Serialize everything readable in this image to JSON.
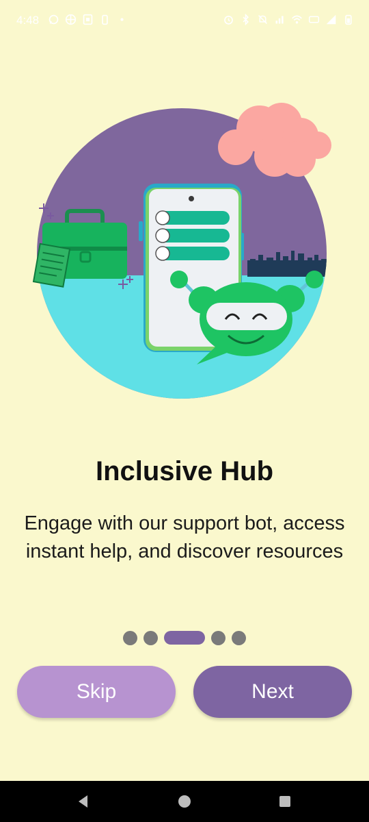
{
  "status_bar": {
    "time": "4:48",
    "left_icons": [
      "whatsapp-icon",
      "browser-icon",
      "screenshot-icon",
      "battery-saver-icon",
      "dot-icon"
    ],
    "right_icons": [
      "alarm-icon",
      "bluetooth-icon",
      "mute-icon",
      "signal-data-icon",
      "wifi-icon",
      "volte-icon",
      "cell-signal-icon",
      "battery-icon"
    ]
  },
  "onboarding": {
    "title": "Inclusive Hub",
    "description": "Engage with our support bot, access instant help, and discover resources",
    "page_count": 5,
    "current_page": 3
  },
  "buttons": {
    "skip": "Skip",
    "next": "Next"
  },
  "nav_bar": {
    "icons": [
      "back-icon",
      "home-icon",
      "recents-icon"
    ]
  },
  "colors": {
    "background": "#faf8cd",
    "primary": "#7e65a2",
    "secondary": "#b793d0",
    "indicator_inactive": "#7a7a7a",
    "illustration_purple": "#7f679d",
    "illustration_teal": "#5fe0e6",
    "bot_green": "#1ec463",
    "cloud_pink": "#fba7a1"
  }
}
